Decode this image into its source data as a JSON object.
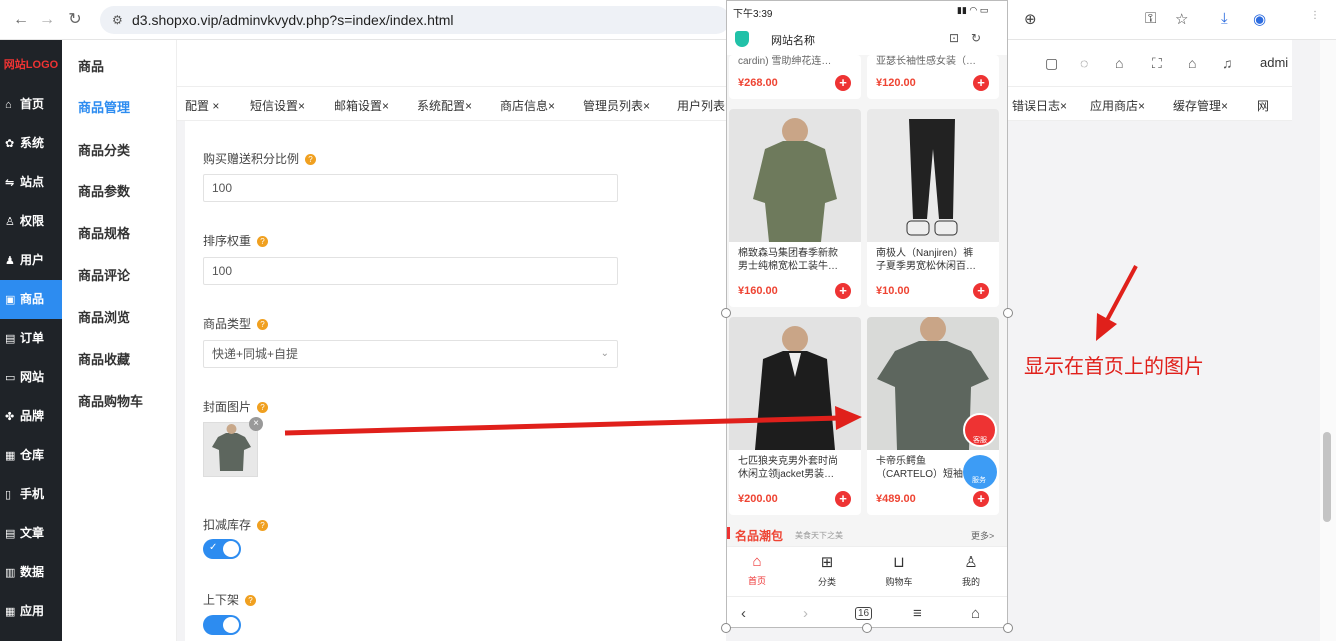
{
  "browser": {
    "url": "d3.shopxo.vip/adminvkvydv.php?s=index/index.html"
  },
  "sidebar": {
    "logo": "网站LOGO",
    "items": [
      {
        "label": "首页",
        "icon": "home-icon",
        "glyph": "⌂"
      },
      {
        "label": "系统",
        "icon": "gear-icon",
        "glyph": "✿"
      },
      {
        "label": "站点",
        "icon": "sliders-icon",
        "glyph": "⇋"
      },
      {
        "label": "权限",
        "icon": "user-key-icon",
        "glyph": "♙"
      },
      {
        "label": "用户",
        "icon": "user-icon",
        "glyph": "♟"
      },
      {
        "label": "商品",
        "icon": "goods-icon",
        "glyph": "▣",
        "active": true
      },
      {
        "label": "订单",
        "icon": "order-icon",
        "glyph": "▤"
      },
      {
        "label": "网站",
        "icon": "monitor-icon",
        "glyph": "▭"
      },
      {
        "label": "品牌",
        "icon": "brand-icon",
        "glyph": "✤"
      },
      {
        "label": "仓库",
        "icon": "warehouse-icon",
        "glyph": "▦"
      },
      {
        "label": "手机",
        "icon": "phone-icon",
        "glyph": "▯"
      },
      {
        "label": "文章",
        "icon": "article-icon",
        "glyph": "▤"
      },
      {
        "label": "数据",
        "icon": "chart-icon",
        "glyph": "▥"
      },
      {
        "label": "应用",
        "icon": "apps-icon",
        "glyph": "▦"
      }
    ]
  },
  "subnav": {
    "title": "商品",
    "items": [
      "商品管理",
      "商品分类",
      "商品参数",
      "商品规格",
      "商品评论",
      "商品浏览",
      "商品收藏",
      "商品购物车"
    ]
  },
  "header": {
    "admin": "admi"
  },
  "tabs": [
    "配置 ×",
    "短信设置×",
    "邮箱设置×",
    "系统配置×",
    "商店信息×",
    "管理员列表×",
    "用户列表×",
    "错误日志×",
    "应用商店×",
    "缓存管理×",
    "网"
  ],
  "form": {
    "points_label": "购买赠送积分比例",
    "points_value": "100",
    "sort_label": "排序权重",
    "sort_value": "100",
    "type_label": "商品类型",
    "type_value": "快递+同城+自提",
    "cover_label": "封面图片",
    "stock_label": "扣减库存",
    "shelf_label": "上下架"
  },
  "phone": {
    "status_time": "下午3:39",
    "site_name": "网站名称",
    "top_prices": [
      "¥268.00",
      "¥120.00"
    ],
    "top_titles": [
      "cardin) 雪助绅花连…",
      "亚瑟长袖性感女装（…"
    ],
    "products": [
      {
        "title1": "棉致森马集团春季新款",
        "title2": "男士纯棉宽松工装牛…",
        "price": "¥160.00"
      },
      {
        "title1": "南极人（Nanjiren）裤",
        "title2": "子夏季男宽松休闲百…",
        "price": "¥10.00"
      },
      {
        "title1": "七匹狼夹克男外套时尚",
        "title2": "休闲立领jacket男装…",
        "price": "¥200.00"
      },
      {
        "title1": "卡帝乐鳄鱼",
        "title2": "（CARTELO）短袖",
        "price": "¥489.00"
      }
    ],
    "section_title": "名品潮包",
    "section_sub": "美食天下之美",
    "section_more": "更多>",
    "tabbar": [
      "首页",
      "分类",
      "购物车",
      "我的"
    ],
    "badge_service": "客服",
    "badge_service2": "服务",
    "tab_badge": "16"
  },
  "annotation": "显示在首页上的图片",
  "colors": {
    "accent": "#2d8cf0",
    "sidebar": "#1f2328",
    "arrow": "#e0201b"
  }
}
